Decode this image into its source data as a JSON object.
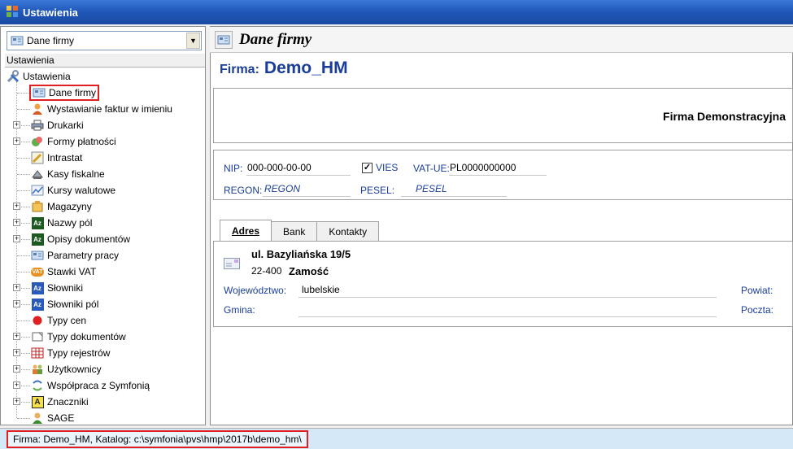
{
  "window": {
    "title": "Ustawienia"
  },
  "left": {
    "combo_value": "Dane firmy",
    "panel_header": "Ustawienia",
    "tree": [
      {
        "label": "Ustawienia",
        "icon": "tools-icon"
      },
      {
        "label": "Dane firmy",
        "icon": "company-icon"
      },
      {
        "label": "Wystawianie faktur w imieniu",
        "icon": "person-icon"
      },
      {
        "label": "Drukarki",
        "icon": "printer-icon"
      },
      {
        "label": "Formy płatności",
        "icon": "payment-icon"
      },
      {
        "label": "Intrastat",
        "icon": "pencil-icon"
      },
      {
        "label": "Kasy fiskalne",
        "icon": "register-icon"
      },
      {
        "label": "Kursy walutowe",
        "icon": "chart-icon"
      },
      {
        "label": "Magazyny",
        "icon": "warehouse-icon"
      },
      {
        "label": "Nazwy pól",
        "icon": "az-icon"
      },
      {
        "label": "Opisy dokumentów",
        "icon": "az-icon"
      },
      {
        "label": "Parametry pracy",
        "icon": "company-icon"
      },
      {
        "label": "Stawki VAT",
        "icon": "vat-icon"
      },
      {
        "label": "Słowniki",
        "icon": "az-blue-icon"
      },
      {
        "label": "Słowniki pól",
        "icon": "az-blue-icon"
      },
      {
        "label": "Typy cen",
        "icon": "red-dot-icon"
      },
      {
        "label": "Typy dokumentów",
        "icon": "document-icon"
      },
      {
        "label": "Typy rejestrów",
        "icon": "grid-icon"
      },
      {
        "label": "Użytkownicy",
        "icon": "users-icon"
      },
      {
        "label": "Współpraca z Symfonią",
        "icon": "sync-icon"
      },
      {
        "label": "Znaczniki",
        "icon": "a-icon"
      },
      {
        "label": "SAGE",
        "icon": "person-green-icon"
      }
    ],
    "icon_glyphs": {
      "az": "Az",
      "vat": "VAT",
      "a": "A"
    }
  },
  "right": {
    "title": "Dane firmy",
    "firma_label": "Firma:",
    "firma_value": "Demo_HM",
    "full_name": "Firma Demonstracyjna",
    "nip_label": "NIP:",
    "nip_value": "000-000-00-00",
    "vies_label": "VIES",
    "vies_checked": true,
    "vatue_label": "VAT-UE:",
    "vatue_value": "PL0000000000",
    "regon_label": "REGON:",
    "regon_value": "REGON",
    "pesel_label": "PESEL:",
    "pesel_value": "PESEL",
    "tabs": [
      {
        "label": "Adres",
        "active": true
      },
      {
        "label": "Bank",
        "active": false
      },
      {
        "label": "Kontakty",
        "active": false
      }
    ],
    "address": {
      "street": "ul. Bazyliańska 19/5",
      "postal": "22-400",
      "city": "Zamość",
      "wojewodztwo_label": "Województwo:",
      "wojewodztwo_value": "lubelskie",
      "gmina_label": "Gmina:",
      "gmina_value": "",
      "powiat_label": "Powiat:",
      "poczta_label": "Poczta:"
    }
  },
  "status": {
    "text": "Firma: Demo_HM, Katalog: c:\\symfonia\\pvs\\hmp\\2017b\\demo_hm\\"
  }
}
